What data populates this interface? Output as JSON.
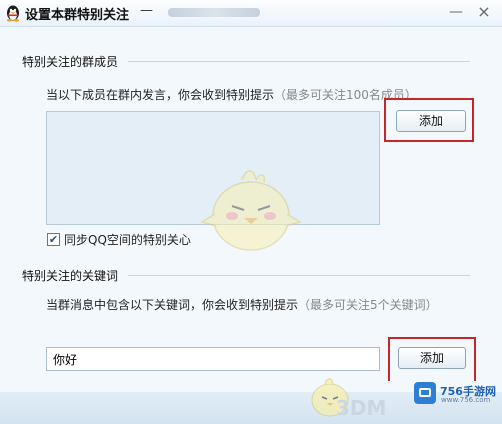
{
  "window": {
    "title": "设置本群特别关注",
    "title_dash": "—",
    "minimize_glyph": "—",
    "close_glyph": "×"
  },
  "members_section": {
    "title": "特别关注的群成员",
    "description": "当以下成员在群内发言，你会收到特别提示",
    "hint": "（最多可关注100名成员）",
    "add_button": "添加",
    "sync_checked": true,
    "sync_label": "同步QQ空间的特别关心"
  },
  "keywords_section": {
    "title": "特别关注的关键词",
    "description": "当群消息中包含以下关键词，你会收到特别提示",
    "hint": "（最多可关注5个关键词）",
    "input_value": "你好",
    "add_button": "添加"
  },
  "watermark": {
    "site": "756手游网",
    "url": "www.756.com",
    "brand": "3DM"
  },
  "colors": {
    "highlight_box": "#c4262b",
    "list_background": "#e3eef7",
    "window_background": "#f3f8fc"
  },
  "icons": [
    "qq-penguin-icon",
    "minimize-icon",
    "close-icon",
    "checkbox-check-icon",
    "chick-mascot-icon"
  ]
}
